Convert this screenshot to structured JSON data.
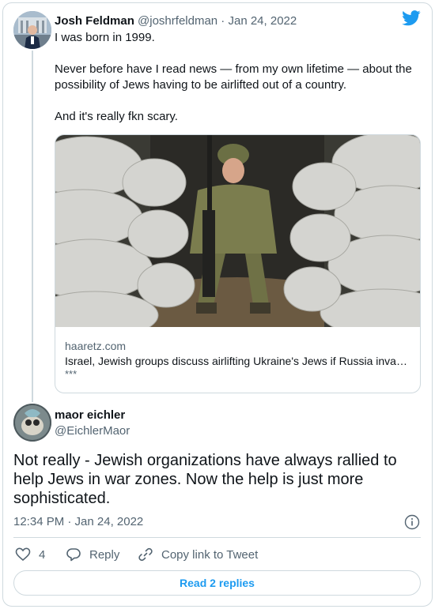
{
  "quoted_tweet": {
    "name": "Josh Feldman",
    "handle": "@joshrfeldman",
    "date": "Jan 24, 2022",
    "text": [
      "I was born in 1999.",
      "Never before have I read news — from my own lifetime — about the possibility of Jews having to be airlifted out of a country.",
      "And it's really fkn scary."
    ],
    "link_card": {
      "domain": "haaretz.com",
      "title": "Israel, Jewish groups discuss airlifting Ukraine's Jews if Russia invades",
      "description": "***"
    }
  },
  "reply_tweet": {
    "name": "maor eichler",
    "handle": "@EichlerMaor",
    "text": "Not really - Jewish organizations have always rallied to help Jews in war zones. Now the help is just more sophisticated.",
    "timestamp": "12:34 PM · Jan 24, 2022"
  },
  "actions": {
    "like_count": "4",
    "reply_label": "Reply",
    "copy_label": "Copy link to Tweet"
  },
  "read_replies_label": "Read 2 replies",
  "colors": {
    "accent": "#1d9bf0",
    "text": "#0f1419",
    "secondary": "#536471",
    "border": "#cfd9de"
  }
}
